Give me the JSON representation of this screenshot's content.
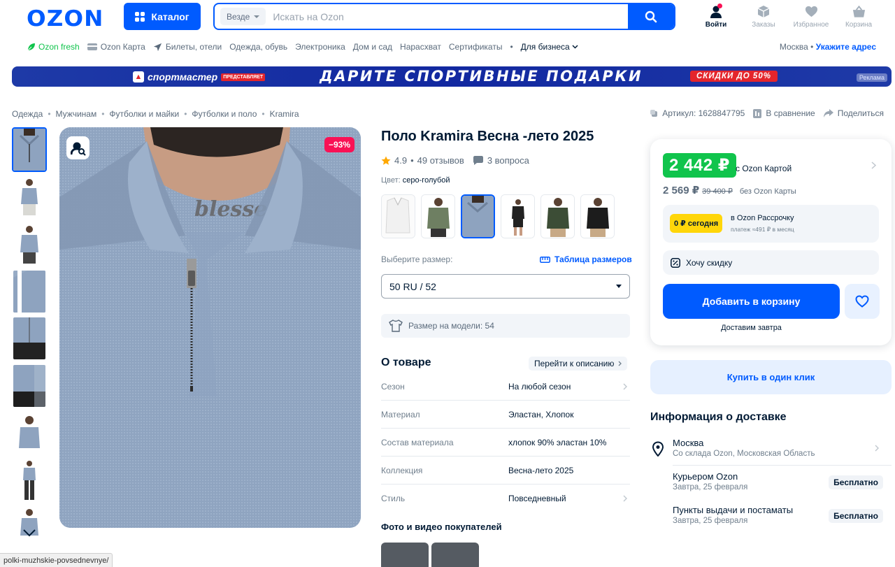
{
  "header": {
    "logo": "OZON",
    "catalog_label": "Каталог",
    "search_scope": "Везде",
    "search_placeholder": "Искать на Ozon",
    "actions": [
      {
        "label": "Войти",
        "icon": "user-icon"
      },
      {
        "label": "Заказы",
        "icon": "box-icon"
      },
      {
        "label": "Избранное",
        "icon": "heart-icon"
      },
      {
        "label": "Корзина",
        "icon": "cart-icon"
      }
    ]
  },
  "subnav": {
    "items": [
      "Ozon fresh",
      "Ozon Карта",
      "Билеты, отели",
      "Одежда, обувь",
      "Электроника",
      "Дом и сад",
      "Нарасхват",
      "Сертификаты",
      "Для бизнеса"
    ],
    "city": "Москва",
    "address_link": "Укажите адрес"
  },
  "banner": {
    "brand": "спортмастер",
    "brand_tag": "ПРЕДСТАВЛЯЕТ",
    "title": "ДАРИТЕ СПОРТИВНЫЕ ПОДАРКИ",
    "sale": "СКИДКИ ДО 50%",
    "ad_label": "Реклама"
  },
  "breadcrumbs": [
    "Одежда",
    "Мужчинам",
    "Футболки и майки",
    "Футболки и поло",
    "Kramira"
  ],
  "meta": {
    "article": "Артикул: 1628847795",
    "compare": "В сравнение",
    "share": "Поделиться"
  },
  "photo": {
    "discount": "−93%",
    "tattoo_text": "blessed"
  },
  "product": {
    "title": "Поло Kramira Весна -лето 2025",
    "rating": "4.9",
    "reviews": "49 отзывов",
    "questions": "3 вопроса",
    "color_label": "Цвет:",
    "color_value": "серо-голубой",
    "size_label": "Выберите размер:",
    "size_table": "Таблица размеров",
    "size_selected": "50 RU / 52",
    "model_size": "Размер на модели: 54"
  },
  "about": {
    "heading": "О товаре",
    "link": "Перейти к описанию",
    "props": [
      {
        "k": "Сезон",
        "v": "На любой сезон",
        "chev": true
      },
      {
        "k": "Материал",
        "v": "Эластан, Хлопок",
        "chev": false
      },
      {
        "k": "Состав материала",
        "v": "хлопок 90% эластан 10%",
        "chev": false
      },
      {
        "k": "Коллекция",
        "v": "Весна-лето 2025",
        "chev": false
      },
      {
        "k": "Стиль",
        "v": "Повседневный",
        "chev": true
      }
    ],
    "buyer_photos": "Фото и видео покупателей"
  },
  "price": {
    "card_price": "2 442 ₽",
    "card_label": "с Ozon Картой",
    "price": "2 569 ₽",
    "old_price": "39 400 ₽",
    "no_card_label": "без Ozon Карты",
    "installment_badge": "0 ₽ сегодня",
    "installment_title": "в Ozon Рассрочку",
    "installment_note": "платеж ≈491 ₽ в месяц",
    "want_discount": "Хочу скидку",
    "add_to_cart": "Добавить в корзину",
    "delivery_note": "Доставим завтра",
    "one_click": "Купить в один клик"
  },
  "delivery": {
    "heading": "Информация о доставке",
    "city": "Москва",
    "warehouse": "Со склада Ozon, Московская Область",
    "rows": [
      {
        "title": "Курьером Ozon",
        "date": "Завтра, 25 февраля",
        "badge": "Бесплатно"
      },
      {
        "title": "Пункты выдачи и постаматы",
        "date": "Завтра, 25 февраля",
        "badge": "Бесплатно"
      }
    ]
  },
  "statusbar": "polki-muzhskie-povsednevnye/",
  "colors": {
    "brand": "#005bff",
    "sale": "#f91155",
    "green_price": "#10c44c",
    "installment": "#ffd60a"
  }
}
